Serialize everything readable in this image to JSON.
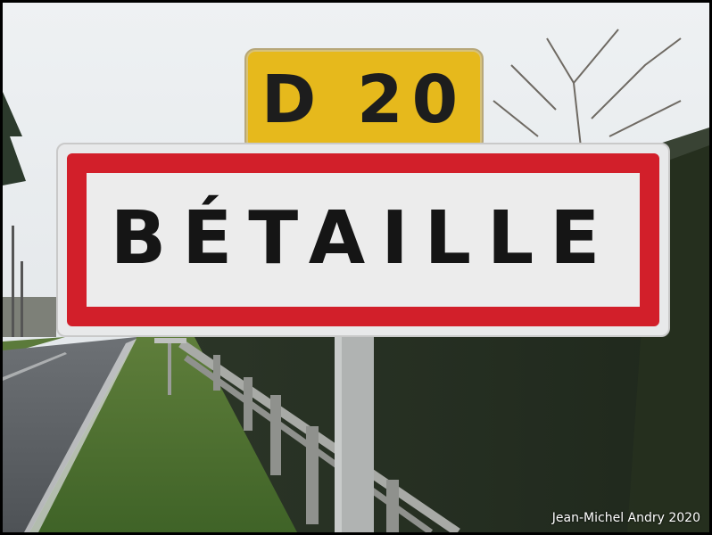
{
  "road_sign": {
    "text": "D 20",
    "color": "#e6b91c"
  },
  "town_sign": {
    "text": "BÉTAILLE",
    "border_color": "#d21f2a"
  },
  "credit": "Jean-Michel Andry 2020"
}
